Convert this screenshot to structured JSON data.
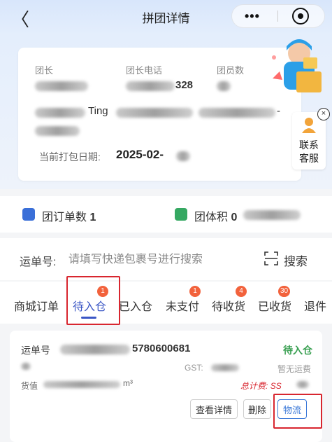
{
  "header": {
    "back_glyph": "〈",
    "title": "拼团详情",
    "menu_glyph": "•••"
  },
  "group_info": {
    "leader_label": "团长",
    "phone_label": "团长电话",
    "members_label": "团员数",
    "phone_visible_suffix": "328",
    "address_visible_fragment": "Ting",
    "address_visible_suffix": "-",
    "pack_date_label": "当前打包日期:",
    "pack_date_value": "2025-02-"
  },
  "contact_service": {
    "label_line1": "联系",
    "label_line2": "客服",
    "close_glyph": "×"
  },
  "stats": {
    "orders_label": "团订单数",
    "orders_count": "1",
    "volume_label": "团体积",
    "volume_value": "0"
  },
  "search": {
    "prefix": "运单号:",
    "placeholder": "请填写快递包裹号进行搜索",
    "button_label": "搜索"
  },
  "tabs": [
    {
      "label": "商城订单",
      "badge": ""
    },
    {
      "label": "待入仓",
      "badge": "1"
    },
    {
      "label": "已入仓",
      "badge": ""
    },
    {
      "label": "未支付",
      "badge": "1"
    },
    {
      "label": "待收货",
      "badge": "4"
    },
    {
      "label": "已收货",
      "badge": "30"
    },
    {
      "label": "退件",
      "badge": ""
    }
  ],
  "order": {
    "waybill_label": "运单号",
    "waybill_visible_suffix": "5780600681",
    "status": "待入仓",
    "gst_label": "GST:",
    "shipping_label": "暂无运费",
    "goods_value_label": "货值",
    "volume_unit": "m³",
    "total_label": "总计费:",
    "total_visible": "SS",
    "btn_details": "查看详情",
    "btn_delete": "删除",
    "btn_logistics": "物流"
  },
  "colors": {
    "accent": "#3a56c5",
    "badge": "#f2623c",
    "status_green": "#3aa052",
    "highlight_red": "#d8262f",
    "header_bg": "#d8e6fb"
  }
}
